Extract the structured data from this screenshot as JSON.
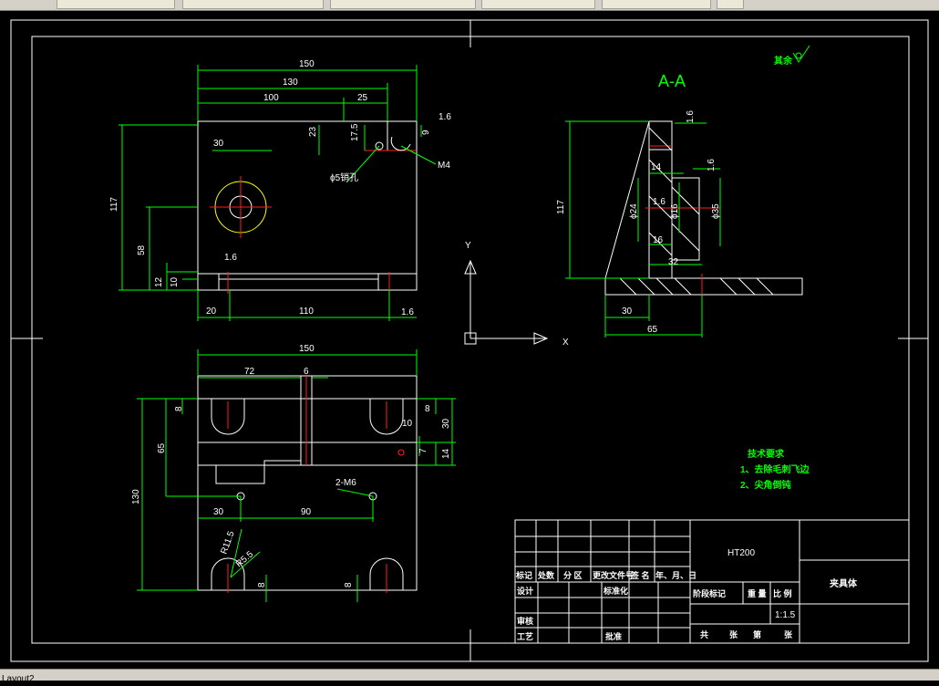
{
  "window": {
    "tabs": [
      "",
      "",
      "",
      "",
      "",
      ""
    ],
    "layout_tab": "Layout2"
  },
  "drawing": {
    "section_label": "A-A",
    "roughness_note": "其余",
    "axis_x": "X",
    "axis_y": "Y",
    "material": "HT200",
    "part_name": "夹具体",
    "scale": "1:1.5",
    "tech_title": "技术要求",
    "tech_notes": [
      "1、去除毛刺飞边",
      "2、尖角倒钝"
    ],
    "title_block": {
      "row_labels": [
        "标记",
        "处数",
        "分 区",
        "更改文件号",
        "签 名",
        "年、月、日"
      ],
      "design": "设计",
      "standard": "标准化",
      "review": "审核",
      "process": "工艺",
      "approve": "批准",
      "stage": "阶段标记",
      "weight": "重 量",
      "ratio": "比 例",
      "sheets": [
        "共",
        "张",
        "第",
        "张"
      ]
    },
    "front_dims": [
      "150",
      "130",
      "100",
      "25",
      "1.6",
      "23",
      "17.5",
      "9",
      "M4",
      "30",
      "ϕ5销孔",
      "117",
      "58",
      "1.6",
      "12",
      "10",
      "20",
      "110",
      "1.6"
    ],
    "top_dims": [
      "150",
      "72",
      "6",
      "8",
      "8",
      "10",
      "30",
      "7",
      "14",
      "65",
      "130",
      "2-M6",
      "30",
      "90",
      "R11.5",
      "R5.5",
      "8",
      "8"
    ],
    "section_dims": [
      "1.6",
      "1.6",
      "14",
      "117",
      "ϕ24",
      "ϕ16",
      "ϕ35",
      "1.6",
      "16",
      "32",
      "30",
      "65"
    ]
  }
}
